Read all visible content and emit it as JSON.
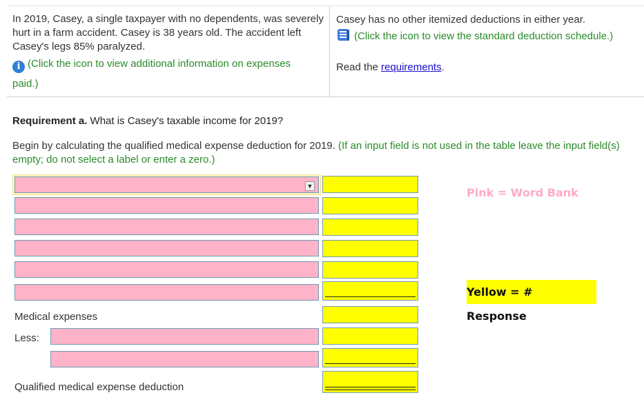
{
  "problem": {
    "left_text": "In 2019, Casey, a single taxpayer with no dependents, was severely hurt in a farm accident. Casey is 38 years old. The accident left Casey's legs 85% paralyzed.",
    "info_note_line1": "(Click the icon to view additional information on expenses",
    "info_note_line2": "paid.)",
    "right_text": "Casey has no other itemized deductions in either year.",
    "std_note": "(Click the icon to view the standard deduction schedule.)",
    "read_prefix": "Read the ",
    "read_link": "requirements",
    "read_suffix": "."
  },
  "requirement": {
    "label": "Requirement a.",
    "question": " What is Casey's taxable income for 2019?",
    "instruction": "Begin by calculating the qualified medical expense deduction for 2019.",
    "note": "(If an input field is not used in the table leave the input field(s) empty; do not  select a label or enter a zero.)"
  },
  "table": {
    "medical_expenses": "Medical expenses",
    "less": "Less:",
    "qualified": "Qualified medical expense deduction"
  },
  "legend": {
    "pink": "Pink = Word Bank",
    "yellow": "Yellow = # Response",
    "pink_color": "#ffb3c8",
    "yellow_color": "#ffff00"
  }
}
